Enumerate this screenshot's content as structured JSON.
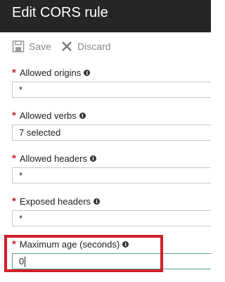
{
  "header": {
    "title": "Edit CORS rule"
  },
  "toolbar": {
    "save_label": "Save",
    "discard_label": "Discard"
  },
  "form": {
    "required_mark": "*",
    "info_glyph": "i",
    "fields": [
      {
        "label": "Allowed origins",
        "value": "*"
      },
      {
        "label": "Allowed verbs",
        "value": "7 selected"
      },
      {
        "label": "Allowed headers",
        "value": "*"
      },
      {
        "label": "Exposed headers",
        "value": "*"
      },
      {
        "label": "Maximum age (seconds)",
        "value": "0"
      }
    ]
  },
  "colors": {
    "header_bg": "#262626",
    "required": "#c4262e",
    "highlight": "#d11f2c"
  }
}
